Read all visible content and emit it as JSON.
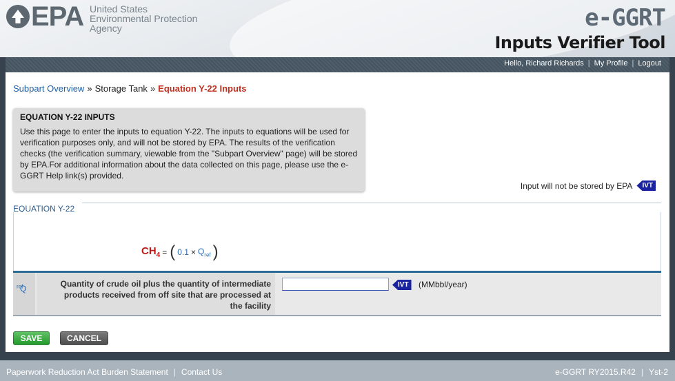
{
  "header": {
    "logo_text": "EPA",
    "agency_lines": [
      "United States",
      "Environmental Protection",
      "Agency"
    ],
    "brand_title": "e-GGRT",
    "brand_subtitle": "Inputs Verifier Tool"
  },
  "userbar": {
    "greeting": "Hello, Richard Richards",
    "profile": "My Profile",
    "logout": "Logout"
  },
  "breadcrumb": {
    "items": [
      "Subpart Overview",
      "Storage Tank",
      "Equation Y-22 Inputs"
    ],
    "separator": "»"
  },
  "info": {
    "title": "EQUATION Y-22 INPUTS",
    "body": "Use this page to enter the inputs to equation Y-22. The inputs to equations will be used for verification purposes only, and will not be stored by EPA. The results of the verification checks (the verification summary, viewable from the \"Subpart Overview\" page) will be stored by EPA.For additional information about the data collected on this page, please use the e-GGRT Help link(s) provided."
  },
  "notice": {
    "text": "Input will not be stored by EPA",
    "badge": "IVT"
  },
  "equation": {
    "label": "EQUATION Y-22",
    "lhs": "CH",
    "lhs_sub": "4",
    "eq": "=",
    "open_paren": "(",
    "coef": "0.1",
    "times": "×",
    "var": "Q",
    "var_sub": "ref",
    "close_paren": ")"
  },
  "input_row": {
    "symbol": "Q",
    "symbol_sub": "ref",
    "description_lines": [
      "Quantity of crude oil plus the quantity of intermediate",
      "products received from off site that are processed at",
      "the facility"
    ],
    "value": "",
    "badge": "IVT",
    "unit": "(MMbbl/year)"
  },
  "buttons": {
    "save": "SAVE",
    "cancel": "CANCEL"
  },
  "footer": {
    "left": [
      "Paperwork Reduction Act Burden Statement",
      "Contact Us"
    ],
    "right": [
      "e-GGRT RY2015.R42",
      "Yst-2"
    ]
  }
}
